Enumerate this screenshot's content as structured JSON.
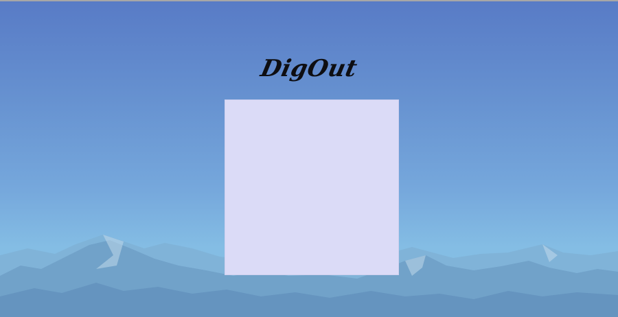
{
  "app": {
    "title": "DigOut"
  },
  "colors": {
    "sky_top": "#587bc6",
    "sky_bottom": "#86c0e4",
    "board_background": "#dbdbf7",
    "title_color": "#0e0e12"
  }
}
